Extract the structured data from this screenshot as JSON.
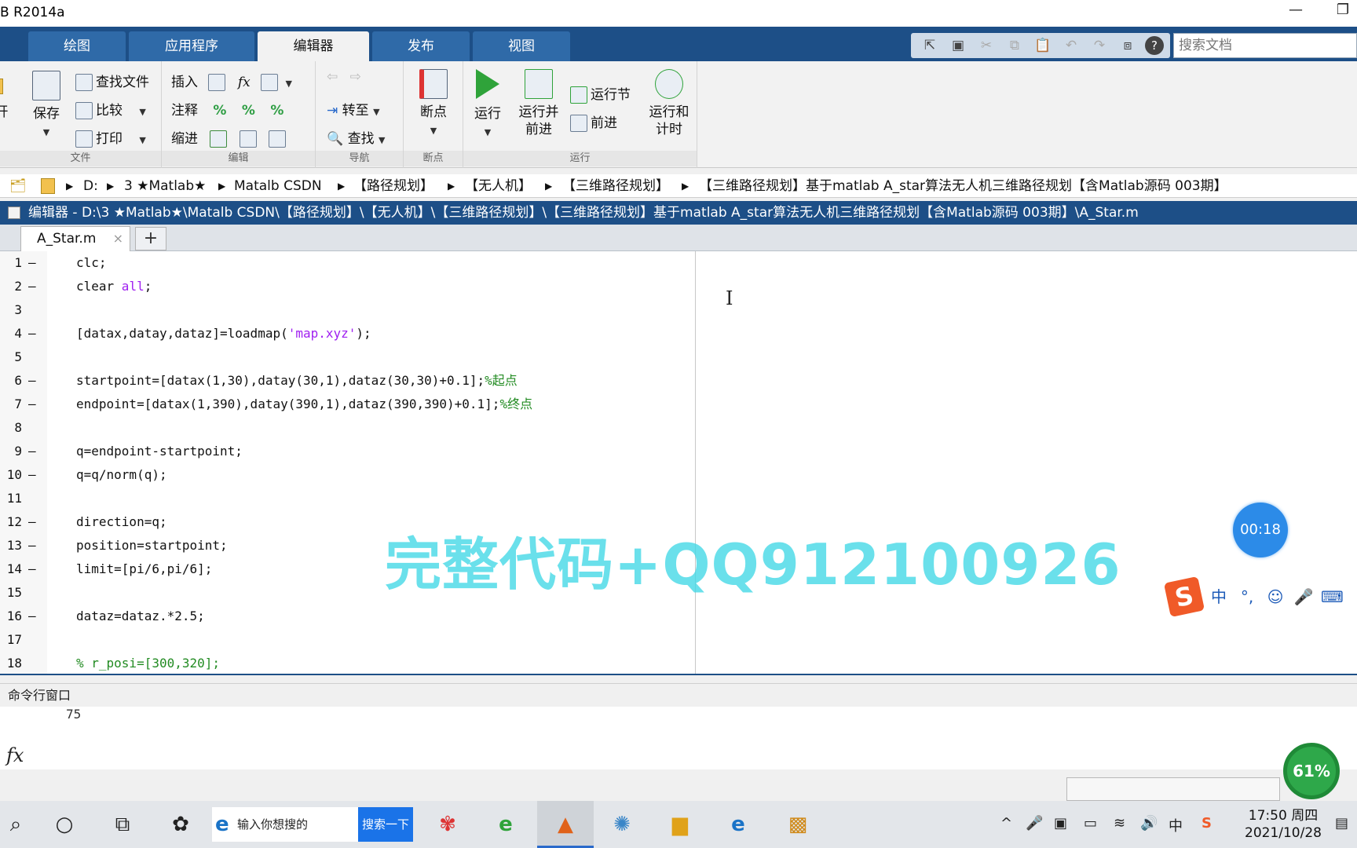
{
  "window": {
    "title": "B R2014a",
    "minimize": "—",
    "restore": "❐"
  },
  "ribbon_tabs": [
    "绘图",
    "应用程序",
    "编辑器",
    "发布",
    "视图"
  ],
  "search_placeholder": "搜索文档",
  "ribbon": {
    "file": {
      "open": "开",
      "save": "保存",
      "find_files": "查找文件",
      "compare": "比较",
      "print": "打印",
      "caption": "文件"
    },
    "edit": {
      "insert": "插入",
      "comment": "注释",
      "indent": "缩进",
      "fx": "fx",
      "caption": "编辑"
    },
    "nav": {
      "goto": "转至",
      "find": "查找",
      "caption": "导航"
    },
    "breakpoint": {
      "label": "断点",
      "caption": "断点"
    },
    "run": {
      "run": "运行",
      "run_advance_1": "运行并",
      "run_advance_2": "前进",
      "run_section": "运行节",
      "advance": "前进",
      "run_time_1": "运行和",
      "run_time_2": "计时",
      "caption": "运行"
    }
  },
  "address": [
    "D:",
    "3 ★Matlab★",
    "Matalb CSDN",
    "【路径规划】",
    "【无人机】",
    "【三维路径规划】",
    "【三维路径规划】基于matlab A_star算法无人机三维路径规划【含Matlab源码 003期】"
  ],
  "editor_title": "编辑器 - D:\\3 ★Matlab★\\Matalb CSDN\\【路径规划】\\【无人机】\\【三维路径规划】\\【三维路径规划】基于matlab A_star算法无人机三维路径规划【含Matlab源码 003期】\\A_Star.m",
  "file_tab": {
    "name": "A_Star.m",
    "close": "×",
    "add": "+"
  },
  "code_lines": [
    {
      "n": "1",
      "dash": "—",
      "code": "clc;"
    },
    {
      "n": "2",
      "dash": "—",
      "code": "clear",
      "kw": " all",
      "tail": ";"
    },
    {
      "n": "3",
      "dash": "",
      "code": ""
    },
    {
      "n": "4",
      "dash": "—",
      "code": "[datax,datay,dataz]=loadmap(",
      "str": "'map.xyz'",
      "tail": ");"
    },
    {
      "n": "5",
      "dash": "",
      "code": ""
    },
    {
      "n": "6",
      "dash": "—",
      "code": "startpoint=[datax(1,30),datay(30,1),dataz(30,30)+0.1];",
      "cmt": "%起点"
    },
    {
      "n": "7",
      "dash": "—",
      "code": "endpoint=[datax(1,390),datay(390,1),dataz(390,390)+0.1];",
      "cmt": "%终点"
    },
    {
      "n": "8",
      "dash": "",
      "code": ""
    },
    {
      "n": "9",
      "dash": "—",
      "code": "q=endpoint-startpoint;"
    },
    {
      "n": "10",
      "dash": "—",
      "code": "q=q/norm(q);"
    },
    {
      "n": "11",
      "dash": "",
      "code": ""
    },
    {
      "n": "12",
      "dash": "—",
      "code": "direction=q;"
    },
    {
      "n": "13",
      "dash": "—",
      "code": "position=startpoint;"
    },
    {
      "n": "14",
      "dash": "—",
      "code": "limit=[pi/6,pi/6];"
    },
    {
      "n": "15",
      "dash": "",
      "code": ""
    },
    {
      "n": "16",
      "dash": "—",
      "code": "dataz=dataz.*2.5;"
    },
    {
      "n": "17",
      "dash": "",
      "code": ""
    },
    {
      "n": "18",
      "dash": "",
      "code": "",
      "cmt": "% r_posi=[300,320];"
    }
  ],
  "watermark": "完整代码+QQ912100926",
  "timer": "00:18",
  "ime": {
    "logo": "S",
    "items": [
      "中",
      "°,",
      "☺",
      "🎤",
      "⌨"
    ]
  },
  "command_window": {
    "title": "命令行窗口",
    "line": "75",
    "fx": "fx"
  },
  "speed_badge": "61%",
  "taskbar": {
    "search_text": "输入你想搜的",
    "search_button": "搜索一下",
    "time": "17:50 周四",
    "date": "2021/10/28",
    "tray": [
      "^",
      "🎤",
      "▣",
      "▭",
      "≋",
      "🔊",
      "中",
      "S"
    ]
  },
  "colors": {
    "ribbon_blue": "#1d4f87",
    "watermark": "#40d7e6",
    "code_string": "#a020f0",
    "code_comment": "#228b22"
  }
}
